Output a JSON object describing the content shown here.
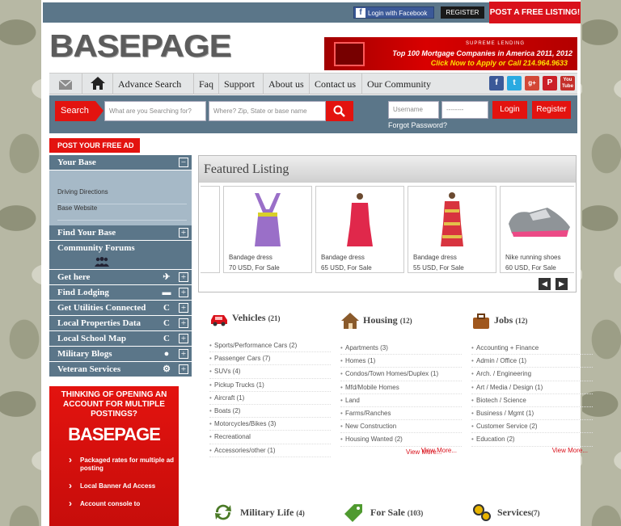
{
  "topbar": {
    "facebook_login": "Login with Facebook",
    "register": "REGISTER",
    "post_free_listing": "POST A FREE LISTING!"
  },
  "logo": "BASEPAGE",
  "ad_banner": {
    "brand": "SUPREME LENDING",
    "line1": "Top 100 Mortgage Companies in America 2011, 2012",
    "line2": "Click Now to Apply or Call 214.964.9633"
  },
  "nav": {
    "items": [
      "Advance Search",
      "Faq",
      "Support",
      "About us",
      "Contact us",
      "Our Community"
    ],
    "social": [
      "f",
      "t",
      "g+",
      "P",
      "You Tube"
    ]
  },
  "search": {
    "label": "Search",
    "what_placeholder": "What are you Searching for?",
    "where_placeholder": "Where? Zip, State or base name",
    "username_placeholder": "Username",
    "password_placeholder": "--------",
    "login": "Login",
    "register": "Register",
    "forgot": "Forgot Password?"
  },
  "post_ad": "POST YOUR FREE AD",
  "sidebar": {
    "your_base": "Your Base",
    "your_base_links": [
      "Driving Directions",
      "Base Website"
    ],
    "find_your_base": "Find Your Base",
    "community_forums": "Community Forums",
    "items": [
      "Get here",
      "Find Lodging",
      "Get Utilities Connected",
      "Local Properties Data",
      "Local School Map",
      "Military Blogs",
      "Veteran Services"
    ],
    "ad": {
      "question": "THINKING OF OPENING AN ACCOUNT FOR MULTIPLE POSTINGS?",
      "logo": "BASEPAGE",
      "points": [
        "Packaged rates for multiple ad posting",
        "Local Banner Ad Access",
        "Account console to"
      ]
    }
  },
  "featured": {
    "title": "Featured Listing",
    "items": [
      {
        "name": "Bandage dress",
        "price": "70 USD, For Sale"
      },
      {
        "name": "Bandage dress",
        "price": "65 USD, For Sale"
      },
      {
        "name": "Bandage dress",
        "price": "55 USD, For Sale"
      },
      {
        "name": "Nike running shoes",
        "price": "60 USD, For Sale"
      }
    ]
  },
  "categories": [
    {
      "title": "Vehicles",
      "count": "(21)",
      "items": [
        "Sports/Performance Cars (2)",
        "Passenger Cars (7)",
        "SUVs (4)",
        "Pickup Trucks (1)",
        "Aircraft (1)",
        "Boats (2)",
        "Motorcycles/Bikes (3)",
        "Recreational",
        "Accessories/other (1)"
      ],
      "more": "View More..."
    },
    {
      "title": "Housing",
      "count": "(12)",
      "items": [
        "Apartments (3)",
        "Homes (1)",
        "Condos/Town Homes/Duplex (1)",
        "Mfd/Mobile Homes",
        "Land",
        "Farms/Ranches",
        "New Construction",
        "Housing Wanted (2)"
      ],
      "more": "View More..."
    },
    {
      "title": "Jobs",
      "count": "(12)",
      "items": [
        "Accounting + Finance",
        "Admin / Office (1)",
        "Arch. / Engineering",
        "Art / Media / Design (1)",
        "Biotech / Science",
        "Business / Mgmt (1)",
        "Customer Service (2)",
        "Education (2)"
      ],
      "more": "View More..."
    }
  ],
  "bottom_categories": [
    {
      "title": "Military Life",
      "count": "(4)"
    },
    {
      "title": "For Sale",
      "count": "(103)"
    },
    {
      "title": "Services",
      "count": "(7)"
    }
  ],
  "colors": {
    "accent_red": "#e3130f",
    "nav_blue": "#5b7689"
  }
}
